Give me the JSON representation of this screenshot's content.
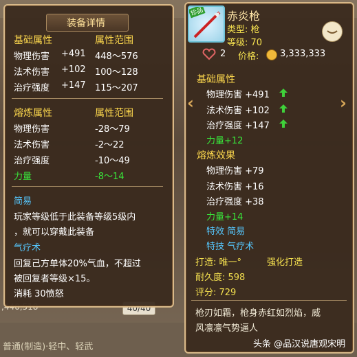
{
  "left_panel": {
    "title": "装备详情",
    "base_header": "基础属性",
    "range_header": "属性范围",
    "base_rows": [
      {
        "name": "物理伤害",
        "value": "+491",
        "range": "448～576"
      },
      {
        "name": "法术伤害",
        "value": "+102",
        "range": "100～128"
      },
      {
        "name": "治疗强度",
        "value": "+147",
        "range": "115～207"
      }
    ],
    "refine_header": "熔炼属性",
    "refine_range_header": "属性范围",
    "refine_rows": [
      {
        "name": "物理伤害",
        "range": "-28～79"
      },
      {
        "name": "法术伤害",
        "range": "-2～22"
      },
      {
        "name": "治疗强度",
        "range": "-10～49"
      },
      {
        "name": "力量",
        "range": "-8～14"
      }
    ],
    "easy_title": "简易",
    "easy_desc_1": "玩家等级低于此装备等级5级内",
    "easy_desc_2": "，就可以穿戴此装备",
    "qi_title": "气疗术",
    "qi_desc_1": "回复己方单体20%气血，不超过",
    "qi_desc_2": "被回复者等级×15。",
    "consume": "消耗 30愤怒"
  },
  "right_panel": {
    "item_name": "赤炎枪",
    "type_label": "类型: 枪",
    "level_label": "等级: 70",
    "badge": "珍品",
    "likes": "2",
    "price_label": "价格:",
    "price": "3,333,333",
    "base_header": "基础属性",
    "base_rows": [
      {
        "text": "物理伤害 +491"
      },
      {
        "text": "法术伤害 +102"
      },
      {
        "text": "治疗强度 +147"
      }
    ],
    "base_extra": "力量+12",
    "refine_header": "熔炼效果",
    "refine_rows": [
      {
        "text": "物理伤害 +79"
      },
      {
        "text": "法术伤害 +16"
      },
      {
        "text": "治疗强度 +38"
      }
    ],
    "refine_extra": "力量+14",
    "special_effect": "特效 简易",
    "special_skill": "特技 气疗术",
    "forge_label": "打造: 唯一°",
    "forge_button": "强化打造",
    "durability": "耐久度: 598",
    "score": "评分: 729",
    "flavor_1": "枪刃如霜，枪身赤红如烈焰，威",
    "flavor_2": "风凛凛气势逼人"
  },
  "background": {
    "page_counter": "40/40",
    "bottom_number": ",440,518",
    "bottom_text": "普通(制造)·轻中、轻武"
  },
  "watermark": {
    "text": "头条 @品汉说唐观宋明"
  },
  "colors": {
    "panel_bg": "#3a2a1e",
    "panel_border": "#d8b98a",
    "section_yellow": "#fdd84d",
    "green": "#39e83b",
    "blue": "#56c8ff"
  }
}
